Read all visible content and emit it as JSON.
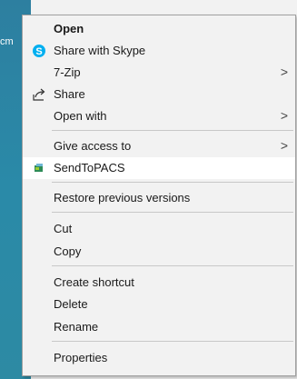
{
  "desktop": {
    "label": "cm"
  },
  "menu": {
    "open": "Open",
    "share_skype": "Share with Skype",
    "zip": "7-Zip",
    "share": "Share",
    "open_with": "Open with",
    "give_access": "Give access to",
    "send_to_pacs": "SendToPACS",
    "restore": "Restore previous versions",
    "cut": "Cut",
    "copy": "Copy",
    "create_shortcut": "Create shortcut",
    "delete": "Delete",
    "rename": "Rename",
    "properties": "Properties",
    "arrow": ">"
  },
  "icons": {
    "skype": "skype-icon",
    "share": "share-icon",
    "pacs": "sendtopacs-icon",
    "skype_color": "#00aff0",
    "pacs_color": "#2e8b57"
  }
}
